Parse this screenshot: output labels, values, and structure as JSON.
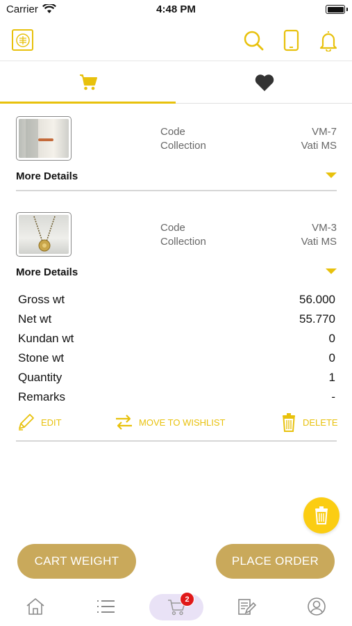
{
  "status": {
    "carrier": "Carrier",
    "time": "4:48 PM"
  },
  "colors": {
    "accent": "#e8c10c",
    "button": "#c9a95b",
    "badge": "#e01919"
  },
  "tabs": [
    {
      "icon": "cart-icon",
      "active": true
    },
    {
      "icon": "heart-icon",
      "active": false
    }
  ],
  "items": [
    {
      "code_label": "Code",
      "code": "VM-7",
      "collection_label": "Collection",
      "collection": "Vati MS",
      "more_label": "More Details",
      "expanded": false
    },
    {
      "code_label": "Code",
      "code": "VM-3",
      "collection_label": "Collection",
      "collection": "Vati MS",
      "more_label": "More Details",
      "expanded": true,
      "details": [
        {
          "label": "Gross wt",
          "value": "56.000"
        },
        {
          "label": "Net wt",
          "value": "55.770"
        },
        {
          "label": "Kundan wt",
          "value": "0"
        },
        {
          "label": "Stone wt",
          "value": "0"
        },
        {
          "label": "Quantity",
          "value": "1"
        },
        {
          "label": "Remarks",
          "value": "-"
        }
      ],
      "actions": {
        "edit": "EDIT",
        "move": "MOVE TO WISHLIST",
        "delete": "DELETE"
      }
    }
  ],
  "buttons": {
    "cart_weight": "CART WEIGHT",
    "place_order": "PLACE ORDER"
  },
  "bottom_nav": {
    "items": [
      "home-icon",
      "list-icon",
      "cart-icon",
      "order-edit-icon",
      "profile-icon"
    ],
    "cart_count": "2"
  }
}
